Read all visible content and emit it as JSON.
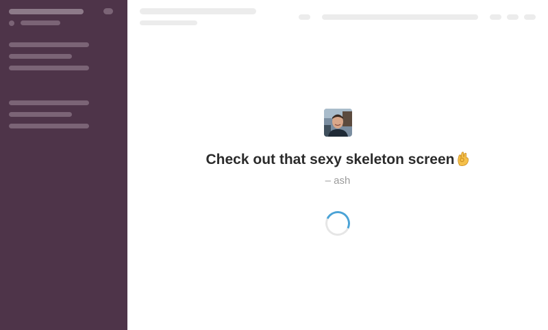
{
  "sidebar": {
    "background": "#4e3449"
  },
  "loading": {
    "message": "Check out that sexy skeleton screen",
    "emoji_icon": "ok-hand-icon",
    "author": "– ash",
    "spinner_color": "#4ba3d6"
  }
}
